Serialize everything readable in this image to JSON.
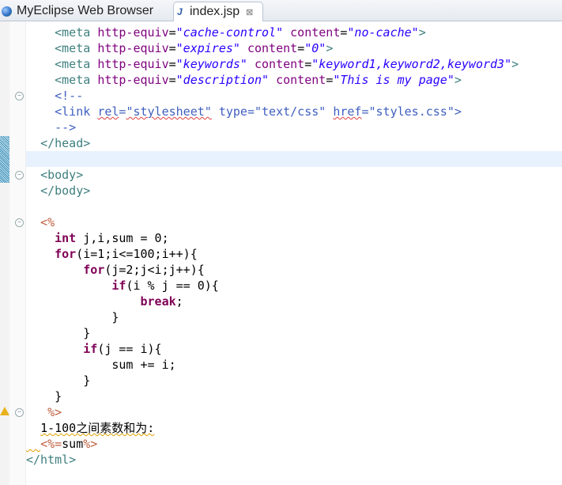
{
  "tabs": [
    {
      "label": "MyEclipse Web Browser",
      "icon": "globe-icon",
      "active": false
    },
    {
      "label": "index.jsp",
      "icon": "jsp-file-icon",
      "active": true,
      "close": "⊠"
    }
  ],
  "colors": {
    "tag": "#3f7f7f",
    "attr": "#7f007f",
    "value": "#2a00ff",
    "comment": "#3f5fbf",
    "keyword": "#7f0055",
    "jsp": "#bf5f3f"
  },
  "code": {
    "lines": [
      [
        {
          "t": "    "
        },
        {
          "t": "<meta",
          "c": "tag"
        },
        {
          "t": " "
        },
        {
          "t": "http-equiv",
          "c": "attr"
        },
        {
          "t": "="
        },
        {
          "t": "\"cache-control\"",
          "c": "val"
        },
        {
          "t": " "
        },
        {
          "t": "content",
          "c": "attr"
        },
        {
          "t": "="
        },
        {
          "t": "\"no-cache\"",
          "c": "val"
        },
        {
          "t": ">",
          "c": "tag"
        }
      ],
      [
        {
          "t": "    "
        },
        {
          "t": "<meta",
          "c": "tag"
        },
        {
          "t": " "
        },
        {
          "t": "http-equiv",
          "c": "attr"
        },
        {
          "t": "="
        },
        {
          "t": "\"expires\"",
          "c": "val"
        },
        {
          "t": " "
        },
        {
          "t": "content",
          "c": "attr"
        },
        {
          "t": "="
        },
        {
          "t": "\"0\"",
          "c": "val"
        },
        {
          "t": ">",
          "c": "tag"
        }
      ],
      [
        {
          "t": "    "
        },
        {
          "t": "<meta",
          "c": "tag"
        },
        {
          "t": " "
        },
        {
          "t": "http-equiv",
          "c": "attr"
        },
        {
          "t": "="
        },
        {
          "t": "\"keywords\"",
          "c": "val"
        },
        {
          "t": " "
        },
        {
          "t": "content",
          "c": "attr"
        },
        {
          "t": "="
        },
        {
          "t": "\"keyword1,keyword2,keyword3\"",
          "c": "val"
        },
        {
          "t": ">",
          "c": "tag"
        }
      ],
      [
        {
          "t": "    "
        },
        {
          "t": "<meta",
          "c": "tag"
        },
        {
          "t": " "
        },
        {
          "t": "http-equiv",
          "c": "attr"
        },
        {
          "t": "="
        },
        {
          "t": "\"description\"",
          "c": "val"
        },
        {
          "t": " "
        },
        {
          "t": "content",
          "c": "attr"
        },
        {
          "t": "="
        },
        {
          "t": "\"This is my page\"",
          "c": "val"
        },
        {
          "t": ">",
          "c": "tag"
        }
      ],
      [
        {
          "t": "    "
        },
        {
          "t": "<!--",
          "c": "cm"
        }
      ],
      [
        {
          "t": "    "
        },
        {
          "t": "<link ",
          "c": "cm"
        },
        {
          "t": "rel",
          "c": "cm sqr"
        },
        {
          "t": "=",
          "c": "cm"
        },
        {
          "t": "\"stylesheet\"",
          "c": "cm sqr"
        },
        {
          "t": " type=\"text/css\" ",
          "c": "cm"
        },
        {
          "t": "href",
          "c": "cm sqr"
        },
        {
          "t": "=\"styles.css\">",
          "c": "cm"
        }
      ],
      [
        {
          "t": "    "
        },
        {
          "t": "-->",
          "c": "cm"
        }
      ],
      [
        {
          "t": "  "
        },
        {
          "t": "</head>",
          "c": "tag"
        }
      ],
      [
        {
          "t": ""
        }
      ],
      [
        {
          "t": "  "
        },
        {
          "t": "<body>",
          "c": "tag"
        }
      ],
      [
        {
          "t": "  "
        },
        {
          "t": "</body>",
          "c": "tag"
        }
      ],
      [
        {
          "t": ""
        }
      ],
      [
        {
          "t": "  "
        },
        {
          "t": "<%",
          "c": "jsp"
        }
      ],
      [
        {
          "t": "    "
        },
        {
          "t": "int",
          "c": "kw"
        },
        {
          "t": " j,i,sum = 0;",
          "c": "txt"
        }
      ],
      [
        {
          "t": "    "
        },
        {
          "t": "for",
          "c": "kw"
        },
        {
          "t": "(i=1;i<=100;i++){",
          "c": "txt"
        }
      ],
      [
        {
          "t": "        "
        },
        {
          "t": "for",
          "c": "kw"
        },
        {
          "t": "(j=2;j<i;j++){",
          "c": "txt"
        }
      ],
      [
        {
          "t": "            "
        },
        {
          "t": "if",
          "c": "kw"
        },
        {
          "t": "(i % j == 0){",
          "c": "txt"
        }
      ],
      [
        {
          "t": "                "
        },
        {
          "t": "break",
          "c": "kw"
        },
        {
          "t": ";",
          "c": "txt"
        }
      ],
      [
        {
          "t": "            }",
          "c": "txt"
        }
      ],
      [
        {
          "t": "        }",
          "c": "txt"
        }
      ],
      [
        {
          "t": "        "
        },
        {
          "t": "if",
          "c": "kw"
        },
        {
          "t": "(j == i){",
          "c": "txt"
        }
      ],
      [
        {
          "t": "            sum += i;",
          "c": "txt"
        }
      ],
      [
        {
          "t": "        }",
          "c": "txt"
        }
      ],
      [
        {
          "t": "    }",
          "c": "txt"
        }
      ],
      [
        {
          "t": "   "
        },
        {
          "t": "%>",
          "c": "jsp"
        }
      ],
      [
        {
          "t": "  "
        },
        {
          "t": "1-100之间素数和为:",
          "c": "txt sq"
        }
      ],
      [
        {
          "t": "  ",
          "c": "sq"
        },
        {
          "t": "<%=",
          "c": "jsp"
        },
        {
          "t": "sum",
          "c": "txt"
        },
        {
          "t": "%>",
          "c": "jsp"
        }
      ],
      [
        {
          "t": "</html>",
          "c": "tag"
        }
      ]
    ]
  }
}
